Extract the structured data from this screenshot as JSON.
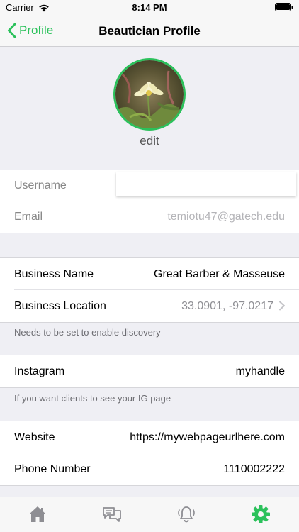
{
  "status_bar": {
    "carrier": "Carrier",
    "time": "8:14 PM"
  },
  "nav": {
    "back_label": "Profile",
    "title": "Beautician Profile"
  },
  "avatar": {
    "edit_label": "edit"
  },
  "account": {
    "username_label": "Username",
    "username_value": "",
    "email_label": "Email",
    "email_value": "temiotu47@gatech.edu"
  },
  "business": {
    "name_label": "Business Name",
    "name_value": "Great Barber & Masseuse",
    "location_label": "Business Location",
    "location_value": "33.0901, -97.0217",
    "note": "Needs to be set to enable discovery"
  },
  "instagram": {
    "label": "Instagram",
    "value": "myhandle",
    "note": "If you want clients to see your IG page"
  },
  "contact": {
    "website_label": "Website",
    "website_value": "https://mywebpageurlhere.com",
    "phone_label": "Phone Number",
    "phone_value": "1110002222"
  },
  "tabs": [
    {
      "icon": "home-icon",
      "active": false
    },
    {
      "icon": "chat-icon",
      "active": false
    },
    {
      "icon": "bell-icon",
      "active": false
    },
    {
      "icon": "gear-icon",
      "active": true
    }
  ],
  "colors": {
    "accent": "#2bc15b",
    "inactive_tab": "#8e8e93"
  }
}
